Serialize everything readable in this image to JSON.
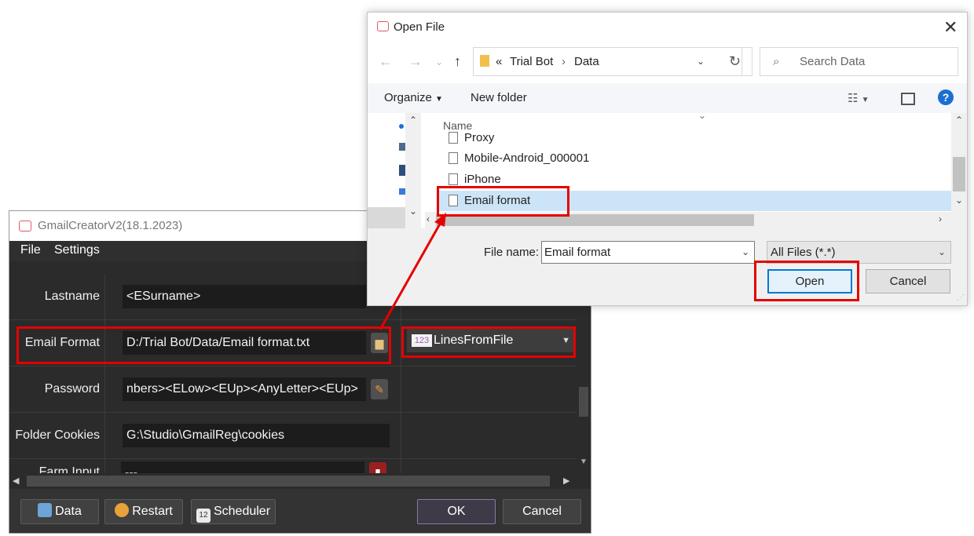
{
  "gmail_window": {
    "title": "GmailCreatorV2(18.1.2023)",
    "menu": [
      "File",
      "Settings"
    ],
    "rows": [
      {
        "label": "Lastname",
        "value": "<ESurname>"
      },
      {
        "label": "Email Format",
        "value": "D:/Trial Bot/Data/Email format.txt",
        "mode": "LinesFromFile",
        "mode_badge": "123"
      },
      {
        "label": "Password",
        "value": "nbers><ELow><EUp><AnyLetter><EUp>"
      },
      {
        "label": "Folder Cookies",
        "value": "G:\\Studio\\GmailReg\\cookies"
      },
      {
        "label": "Farm Input",
        "value": "---"
      }
    ],
    "buttons": {
      "data": "Data",
      "restart": "Restart",
      "scheduler": "Scheduler",
      "scheduler_badge": "12",
      "ok": "OK",
      "cancel": "Cancel"
    }
  },
  "open_dialog": {
    "title": "Open File",
    "breadcrumb": {
      "prefix": "«",
      "parts": [
        "Trial Bot",
        "Data"
      ]
    },
    "search_placeholder": "Search Data",
    "toolbar": {
      "organize": "Organize",
      "new_folder": "New folder"
    },
    "column_header": "Name",
    "files": [
      "Proxy",
      "Mobile-Android_000001",
      "iPhone",
      "Email format"
    ],
    "selected_file": "Email format",
    "file_name_label": "File name:",
    "file_name_value": "Email format",
    "file_type": "All Files (*.*)",
    "open_button": "Open",
    "cancel_button": "Cancel"
  },
  "colors": {
    "highlight": "#e50000",
    "selection": "#cce4f7",
    "dark_bg": "#2b2b2b"
  }
}
